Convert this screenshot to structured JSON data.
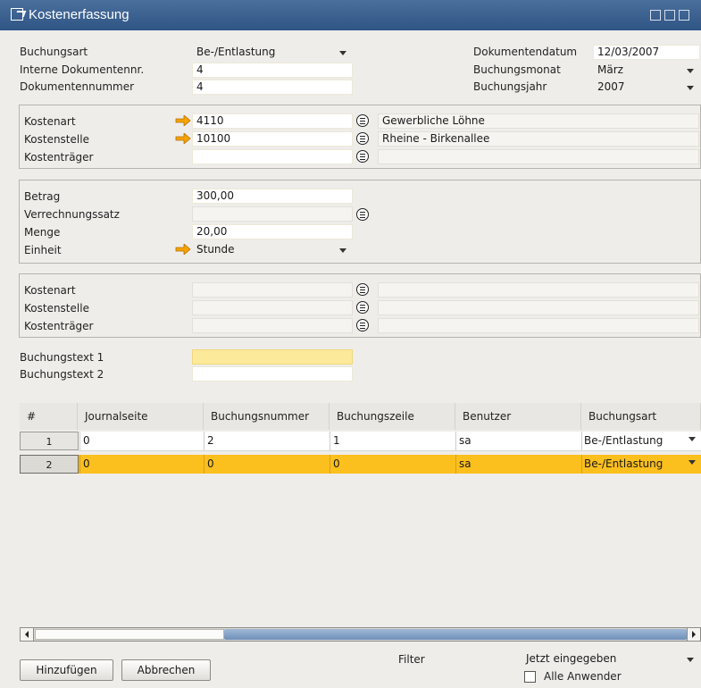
{
  "window": {
    "title": "Kostenerfassung"
  },
  "header": {
    "buchungsart_label": "Buchungsart",
    "buchungsart_value": "Be-/Entlastung",
    "interne_label": "Interne Dokumentennr.",
    "interne_value": "4",
    "dokumentennummer_label": "Dokumentennummer",
    "dokumentennummer_value": "4",
    "dokumentendatum_label": "Dokumentendatum",
    "dokumentendatum_value": "12/03/2007",
    "buchungsmonat_label": "Buchungsmonat",
    "buchungsmonat_value": "März",
    "buchungsjahr_label": "Buchungsjahr",
    "buchungsjahr_value": "2007"
  },
  "group1": {
    "kostenart_label": "Kostenart",
    "kostenart_value": "4110",
    "kostenart_desc": "Gewerbliche Löhne",
    "kostenstelle_label": "Kostenstelle",
    "kostenstelle_value": "10100",
    "kostenstelle_desc": "Rheine - Birkenallee",
    "kostentraeger_label": "Kostenträger",
    "kostentraeger_value": "",
    "kostentraeger_desc": ""
  },
  "group2": {
    "betrag_label": "Betrag",
    "betrag_value": "300,00",
    "verrechnungssatz_label": "Verrechnungssatz",
    "verrechnungssatz_value": "",
    "menge_label": "Menge",
    "menge_value": "20,00",
    "einheit_label": "Einheit",
    "einheit_value": "Stunde"
  },
  "group3": {
    "kostenart_label": "Kostenart",
    "kostenstelle_label": "Kostenstelle",
    "kostentraeger_label": "Kostenträger"
  },
  "texts": {
    "text1_label": "Buchungstext 1",
    "text1_value": "",
    "text2_label": "Buchungstext 2",
    "text2_value": ""
  },
  "table": {
    "columns": [
      "#",
      "Journalseite",
      "Buchungsnummer",
      "Buchungszeile",
      "Benutzer",
      "Buchungsart"
    ],
    "rows": [
      {
        "num": "1",
        "journalseite": "0",
        "buchungsnummer": "2",
        "buchungszeile": "1",
        "benutzer": "sa",
        "buchungsart": "Be-/Entlastung"
      },
      {
        "num": "2",
        "journalseite": "0",
        "buchungsnummer": "0",
        "buchungszeile": "0",
        "benutzer": "sa",
        "buchungsart": "Be-/Entlastung"
      }
    ]
  },
  "footer": {
    "add_label": "Hinzufügen",
    "cancel_label": "Abbrechen",
    "filter_label": "Filter",
    "filter_value": "Jetzt eingegeben",
    "all_users_label": "Alle Anwender"
  },
  "colors": {
    "titlebar": "#3a6190",
    "highlight_row": "#fbbf1e",
    "arrow": "#f5a300",
    "text_field_highlight": "#fde99a"
  }
}
